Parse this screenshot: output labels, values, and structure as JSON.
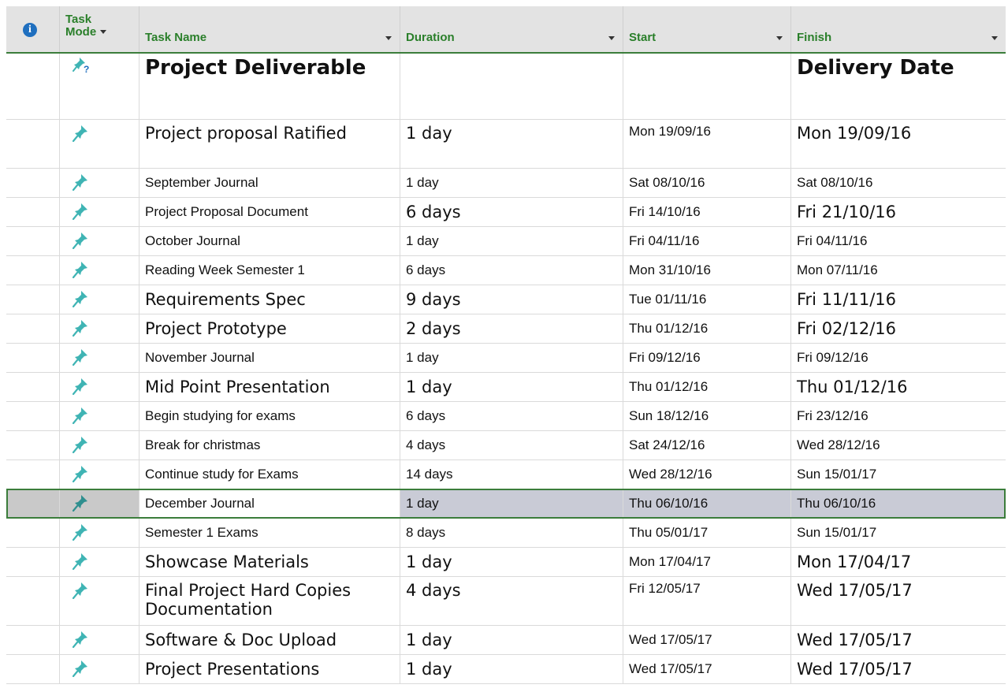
{
  "header": {
    "info_icon": "info-icon",
    "task_mode_line1": "Task",
    "task_mode_line2": "Mode",
    "task_name": "Task Name",
    "duration": "Duration",
    "start": "Start",
    "finish": "Finish"
  },
  "colors": {
    "header_text": "#2a7f2a",
    "pin_icon": "#3fb4b4",
    "selection_border": "#3b7d3b"
  },
  "rows": [
    {
      "mode_icon": "manual-task-unknown-icon",
      "name": "Project Deliverable",
      "duration": "",
      "start": "",
      "finish": "Delivery Date"
    },
    {
      "mode_icon": "manual-task-pin-icon",
      "name": "Project proposal Ratified",
      "duration": "1 day",
      "start": "Mon 19/09/16",
      "finish": "Mon 19/09/16"
    },
    {
      "mode_icon": "manual-task-pin-icon",
      "name": "September Journal",
      "duration": "1 day",
      "start": "Sat 08/10/16",
      "finish": "Sat 08/10/16"
    },
    {
      "mode_icon": "manual-task-pin-icon",
      "name": "Project Proposal Document",
      "duration": "6 days",
      "start": "Fri 14/10/16",
      "finish": "Fri 21/10/16"
    },
    {
      "mode_icon": "manual-task-pin-icon",
      "name": "October Journal",
      "duration": "1 day",
      "start": "Fri 04/11/16",
      "finish": "Fri 04/11/16"
    },
    {
      "mode_icon": "manual-task-pin-icon",
      "name": "Reading Week Semester 1",
      "duration": "6 days",
      "start": "Mon 31/10/16",
      "finish": "Mon 07/11/16"
    },
    {
      "mode_icon": "manual-task-pin-icon",
      "name": "Requirements Spec",
      "duration": "9 days",
      "start": "Tue 01/11/16",
      "finish": "Fri 11/11/16"
    },
    {
      "mode_icon": "manual-task-pin-icon",
      "name": "Project Prototype",
      "duration": "2 days",
      "start": "Thu 01/12/16",
      "finish": "Fri 02/12/16"
    },
    {
      "mode_icon": "manual-task-pin-icon",
      "name": "November Journal",
      "duration": "1 day",
      "start": "Fri 09/12/16",
      "finish": "Fri 09/12/16"
    },
    {
      "mode_icon": "manual-task-pin-icon",
      "name": "Mid Point Presentation",
      "duration": "1 day",
      "start": "Thu 01/12/16",
      "finish": "Thu 01/12/16"
    },
    {
      "mode_icon": "manual-task-pin-icon",
      "name": "Begin studying for exams",
      "duration": "6 days",
      "start": "Sun 18/12/16",
      "finish": "Fri 23/12/16"
    },
    {
      "mode_icon": "manual-task-pin-icon",
      "name": "Break for christmas",
      "duration": "4 days",
      "start": "Sat 24/12/16",
      "finish": "Wed 28/12/16"
    },
    {
      "mode_icon": "manual-task-pin-icon",
      "name": "Continue study for Exams",
      "duration": "14 days",
      "start": "Wed 28/12/16",
      "finish": "Sun 15/01/17"
    },
    {
      "mode_icon": "manual-task-pin-icon",
      "name": "December Journal",
      "duration": "1 day",
      "start": "Thu 06/10/16",
      "finish": "Thu 06/10/16",
      "selected": true
    },
    {
      "mode_icon": "manual-task-pin-icon",
      "name": "Semester 1 Exams",
      "duration": "8 days",
      "start": "Thu 05/01/17",
      "finish": "Sun 15/01/17"
    },
    {
      "mode_icon": "manual-task-pin-icon",
      "name": "Showcase Materials",
      "duration": "1 day",
      "start": "Mon 17/04/17",
      "finish": "Mon 17/04/17"
    },
    {
      "mode_icon": "manual-task-pin-icon",
      "name": "Final Project Hard Copies Documentation",
      "duration": "4 days",
      "start": "Fri 12/05/17",
      "finish": "Wed 17/05/17"
    },
    {
      "mode_icon": "manual-task-pin-icon",
      "name": "Software & Doc Upload",
      "duration": "1 day",
      "start": "Wed 17/05/17",
      "finish": "Wed 17/05/17"
    },
    {
      "mode_icon": "manual-task-pin-icon",
      "name": "Project Presentations",
      "duration": "1 day",
      "start": "Wed 17/05/17",
      "finish": "Wed 17/05/17"
    }
  ]
}
